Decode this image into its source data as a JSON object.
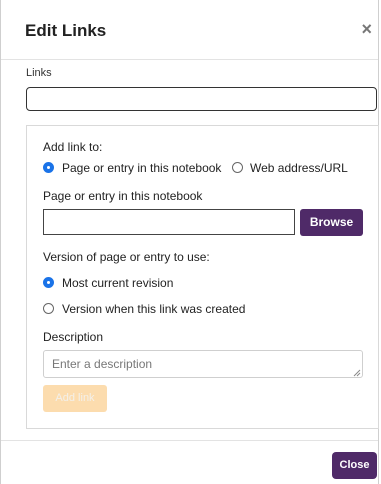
{
  "dialog": {
    "title": "Edit Links",
    "close_glyph": "×"
  },
  "links": {
    "label": "Links",
    "value": ""
  },
  "add_link": {
    "heading": "Add link to:",
    "target_options": [
      {
        "label": "Page or entry in this notebook",
        "selected": true
      },
      {
        "label": "Web address/URL",
        "selected": false
      }
    ],
    "page_label": "Page or entry in this notebook",
    "page_value": "",
    "browse_label": "Browse",
    "version_heading": "Version of page or entry to use:",
    "version_options": [
      {
        "label": "Most current revision",
        "selected": true
      },
      {
        "label": "Version when this link was created",
        "selected": false
      }
    ],
    "description_label": "Description",
    "description_placeholder": "Enter a description",
    "add_button_label": "Add link"
  },
  "footer": {
    "close_label": "Close"
  },
  "colors": {
    "primary": "#4f2a68",
    "radio_selected": "#1a73e8",
    "disabled_button": "#fcdcae"
  },
  "icons": {
    "close": "close-icon",
    "resize": "resize-grip-icon"
  }
}
